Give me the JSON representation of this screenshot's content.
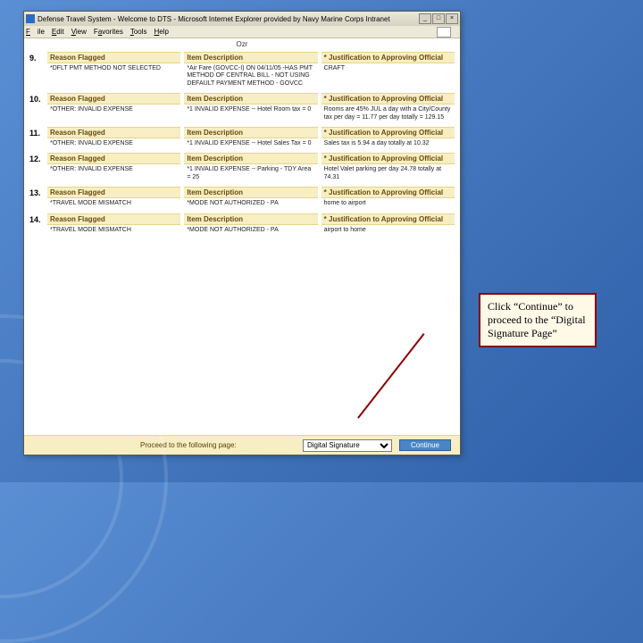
{
  "window": {
    "title": "Defense Travel System - Welcome to DTS - Microsoft Internet Explorer provided by Navy Marine Corps Intranet",
    "menus": {
      "file": "File",
      "edit": "Edit",
      "view": "View",
      "favorites": "Favorites",
      "tools": "Tools",
      "help": "Help"
    },
    "min": "_",
    "max": "□",
    "close": "×"
  },
  "ozr": "Ozr",
  "columns": {
    "reason": "Reason Flagged",
    "desc": "Item Description",
    "just": "* Justification to Approving Official"
  },
  "items": [
    {
      "num": "9.",
      "reason": "*DFLT PMT METHOD NOT SELECTED",
      "desc": "*Air Fare (GOVCC-I) ON 04/11/05 -HAS PMT METHOD OF CENTRAL BILL - NOT USING DEFAULT PAYMENT METHOD - GOVCC",
      "just": "CRAFT"
    },
    {
      "num": "10.",
      "reason": "*OTHER: INVALID EXPENSE",
      "desc": "*1 INVALID EXPENSE -- Hotel Room tax = 0",
      "just": "Rooms are 45% JUL a day with a City/County tax per day = 11.77 per day totally = 129.15"
    },
    {
      "num": "11.",
      "reason": "*OTHER: INVALID EXPENSE",
      "desc": "*1 INVALID EXPENSE -- Hotel Sales Tax = 0",
      "just": "Sales tax is 5.94 a day totally at 10.32"
    },
    {
      "num": "12.",
      "reason": "*OTHER: INVALID EXPENSE",
      "desc": "*1 INVALID EXPENSE -- Parking - TDY Area = 25",
      "just": "Hotel Valet parking per day 24.78 totally at 74.31"
    },
    {
      "num": "13.",
      "reason": "*TRAVEL MODE MISMATCH",
      "desc": "*MODE NOT AUTHORIZED - PA",
      "just": "home to airport"
    },
    {
      "num": "14.",
      "reason": "*TRAVEL MODE MISMATCH",
      "desc": "*MODE NOT AUTHORIZED - PA",
      "just": "airport to home"
    }
  ],
  "footer": {
    "label": "Proceed to the following page:",
    "select": "Digital Signature",
    "continue": "Continue"
  },
  "callout": "Click “Continue” to proceed to the “Digital Signature Page”"
}
